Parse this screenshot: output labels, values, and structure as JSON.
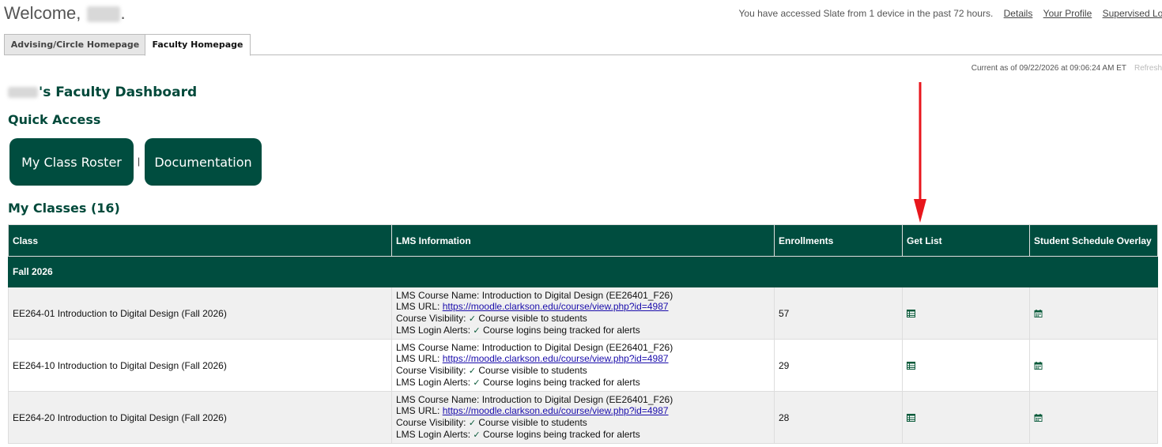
{
  "header": {
    "welcome_prefix": "Welcome,",
    "welcome_suffix": ".",
    "access_text": "You have accessed Slate from 1 device in the past 72 hours.",
    "links": [
      "Details",
      "Your Profile",
      "Supervised Log"
    ]
  },
  "tabs": [
    "Advising/Circle Homepage",
    "Faculty Homepage"
  ],
  "status": {
    "as_of": "Current as of 09/22/2026 at 09:06:24 AM ET",
    "refresh": "Refresh"
  },
  "dashboard": {
    "title_suffix": "'s Faculty Dashboard",
    "quick_access": "Quick Access",
    "buttons": [
      "My Class Roster",
      "Documentation"
    ],
    "separator": "|",
    "my_classes": "My Classes (16)"
  },
  "table": {
    "headers": [
      "Class",
      "LMS Information",
      "Enrollments",
      "Get List",
      "Student Schedule Overlay"
    ],
    "term": "Fall 2026",
    "lms_labels": {
      "name": "LMS Course Name:",
      "url": "LMS URL:",
      "visibility": "Course Visibility:",
      "alerts": "LMS Login Alerts:"
    },
    "rows": [
      {
        "class": "EE264-01 Introduction to Digital Design (Fall 2026)",
        "lms_name": "Introduction to Digital Design (EE26401_F26)",
        "lms_url": "https://moodle.clarkson.edu/course/view.php?id=4987",
        "visibility": "Course visible to students",
        "alerts": "Course logins being tracked for alerts",
        "enrollments": "57"
      },
      {
        "class": "EE264-10 Introduction to Digital Design (Fall 2026)",
        "lms_name": "Introduction to Digital Design (EE26401_F26)",
        "lms_url": "https://moodle.clarkson.edu/course/view.php?id=4987",
        "visibility": "Course visible to students",
        "alerts": "Course logins being tracked for alerts",
        "enrollments": "29"
      },
      {
        "class": "EE264-20 Introduction to Digital Design (Fall 2026)",
        "lms_name": "Introduction to Digital Design (EE26401_F26)",
        "lms_url": "https://moodle.clarkson.edu/course/view.php?id=4987",
        "visibility": "Course visible to students",
        "alerts": "Course logins being tracked for alerts",
        "enrollments": "28"
      }
    ]
  },
  "icons": {
    "get_list": "list-icon",
    "schedule": "calendar-icon",
    "check": "check-icon",
    "annotation": "red-arrow-icon"
  },
  "colors": {
    "brand_green": "#004d3f",
    "annotation_red": "#e8161c"
  }
}
